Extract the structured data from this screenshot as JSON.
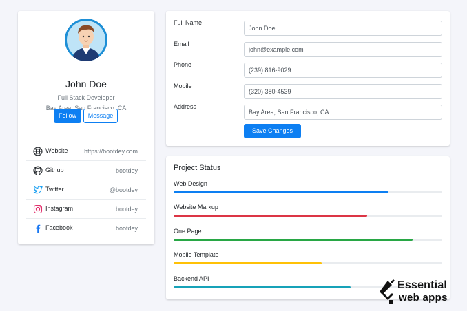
{
  "profile": {
    "name": "John Doe",
    "role": "Full Stack Developer",
    "location": "Bay Area, San Francisco, CA",
    "follow_label": "Follow",
    "message_label": "Message",
    "links": [
      {
        "icon": "globe-icon",
        "label": "Website",
        "value": "https://bootdey.com",
        "color": "#212529"
      },
      {
        "icon": "github-icon",
        "label": "Github",
        "value": "bootdey",
        "color": "#212529"
      },
      {
        "icon": "twitter-icon",
        "label": "Twitter",
        "value": "@bootdey",
        "color": "#1da1f2"
      },
      {
        "icon": "instagram-icon",
        "label": "Instagram",
        "value": "bootdey",
        "color": "#e1306c"
      },
      {
        "icon": "facebook-icon",
        "label": "Facebook",
        "value": "bootdey",
        "color": "#1877f2"
      }
    ]
  },
  "form": {
    "fields": [
      {
        "label": "Full Name",
        "value": "John Doe"
      },
      {
        "label": "Email",
        "value": "john@example.com"
      },
      {
        "label": "Phone",
        "value": "(239) 816-9029"
      },
      {
        "label": "Mobile",
        "value": "(320) 380-4539"
      },
      {
        "label": "Address",
        "value": "Bay Area, San Francisco, CA"
      }
    ],
    "save_label": "Save Changes"
  },
  "status": {
    "title": "Project Status",
    "projects": [
      {
        "label": "Web Design",
        "progress": 0.8,
        "color": "#0d7ff2"
      },
      {
        "label": "Website Markup",
        "progress": 0.72,
        "color": "#dc3545"
      },
      {
        "label": "One Page",
        "progress": 0.89,
        "color": "#28a745"
      },
      {
        "label": "Mobile Template",
        "progress": 0.55,
        "color": "#ffc107"
      },
      {
        "label": "Backend API",
        "progress": 0.66,
        "color": "#17a2b8"
      }
    ]
  },
  "watermark": {
    "line1": "Essential",
    "line2": "web apps"
  },
  "colors": {
    "primary": "#0d7ff2",
    "background": "#f4f5fa"
  }
}
